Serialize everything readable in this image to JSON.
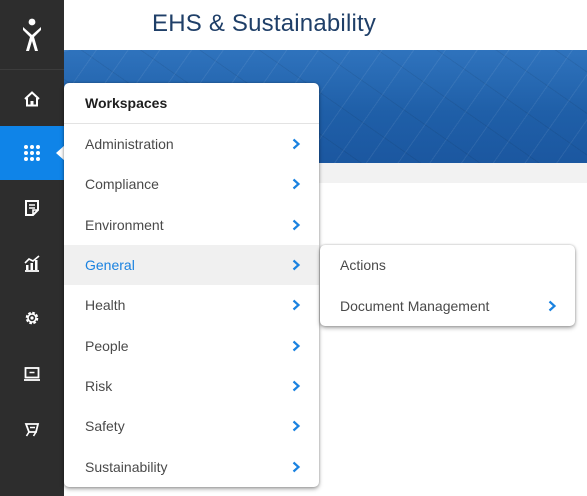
{
  "app": {
    "title": "EHS & Sustainability"
  },
  "colors": {
    "sidebar_bg": "#2d2d2d",
    "accent": "#0f84e8",
    "title": "#1f3f68",
    "selected_text": "#1a82e0"
  },
  "sidebar": {
    "items": [
      {
        "icon": "home-icon",
        "active": false
      },
      {
        "icon": "apps-grid-icon",
        "active": true
      },
      {
        "icon": "form-icon",
        "active": false
      },
      {
        "icon": "chart-icon",
        "active": false
      },
      {
        "icon": "gear-icon",
        "active": false
      },
      {
        "icon": "monitor-icon",
        "active": false
      },
      {
        "icon": "tag-icon",
        "active": false
      }
    ]
  },
  "menu": {
    "header": "Workspaces",
    "items": [
      {
        "label": "Administration"
      },
      {
        "label": "Compliance"
      },
      {
        "label": "Environment"
      },
      {
        "label": "General",
        "selected": true
      },
      {
        "label": "Health"
      },
      {
        "label": "People"
      },
      {
        "label": "Risk"
      },
      {
        "label": "Safety"
      },
      {
        "label": "Sustainability"
      }
    ]
  },
  "submenu": {
    "items": [
      {
        "label": "Actions",
        "has_children": false
      },
      {
        "label": "Document Management",
        "has_children": true
      }
    ]
  }
}
